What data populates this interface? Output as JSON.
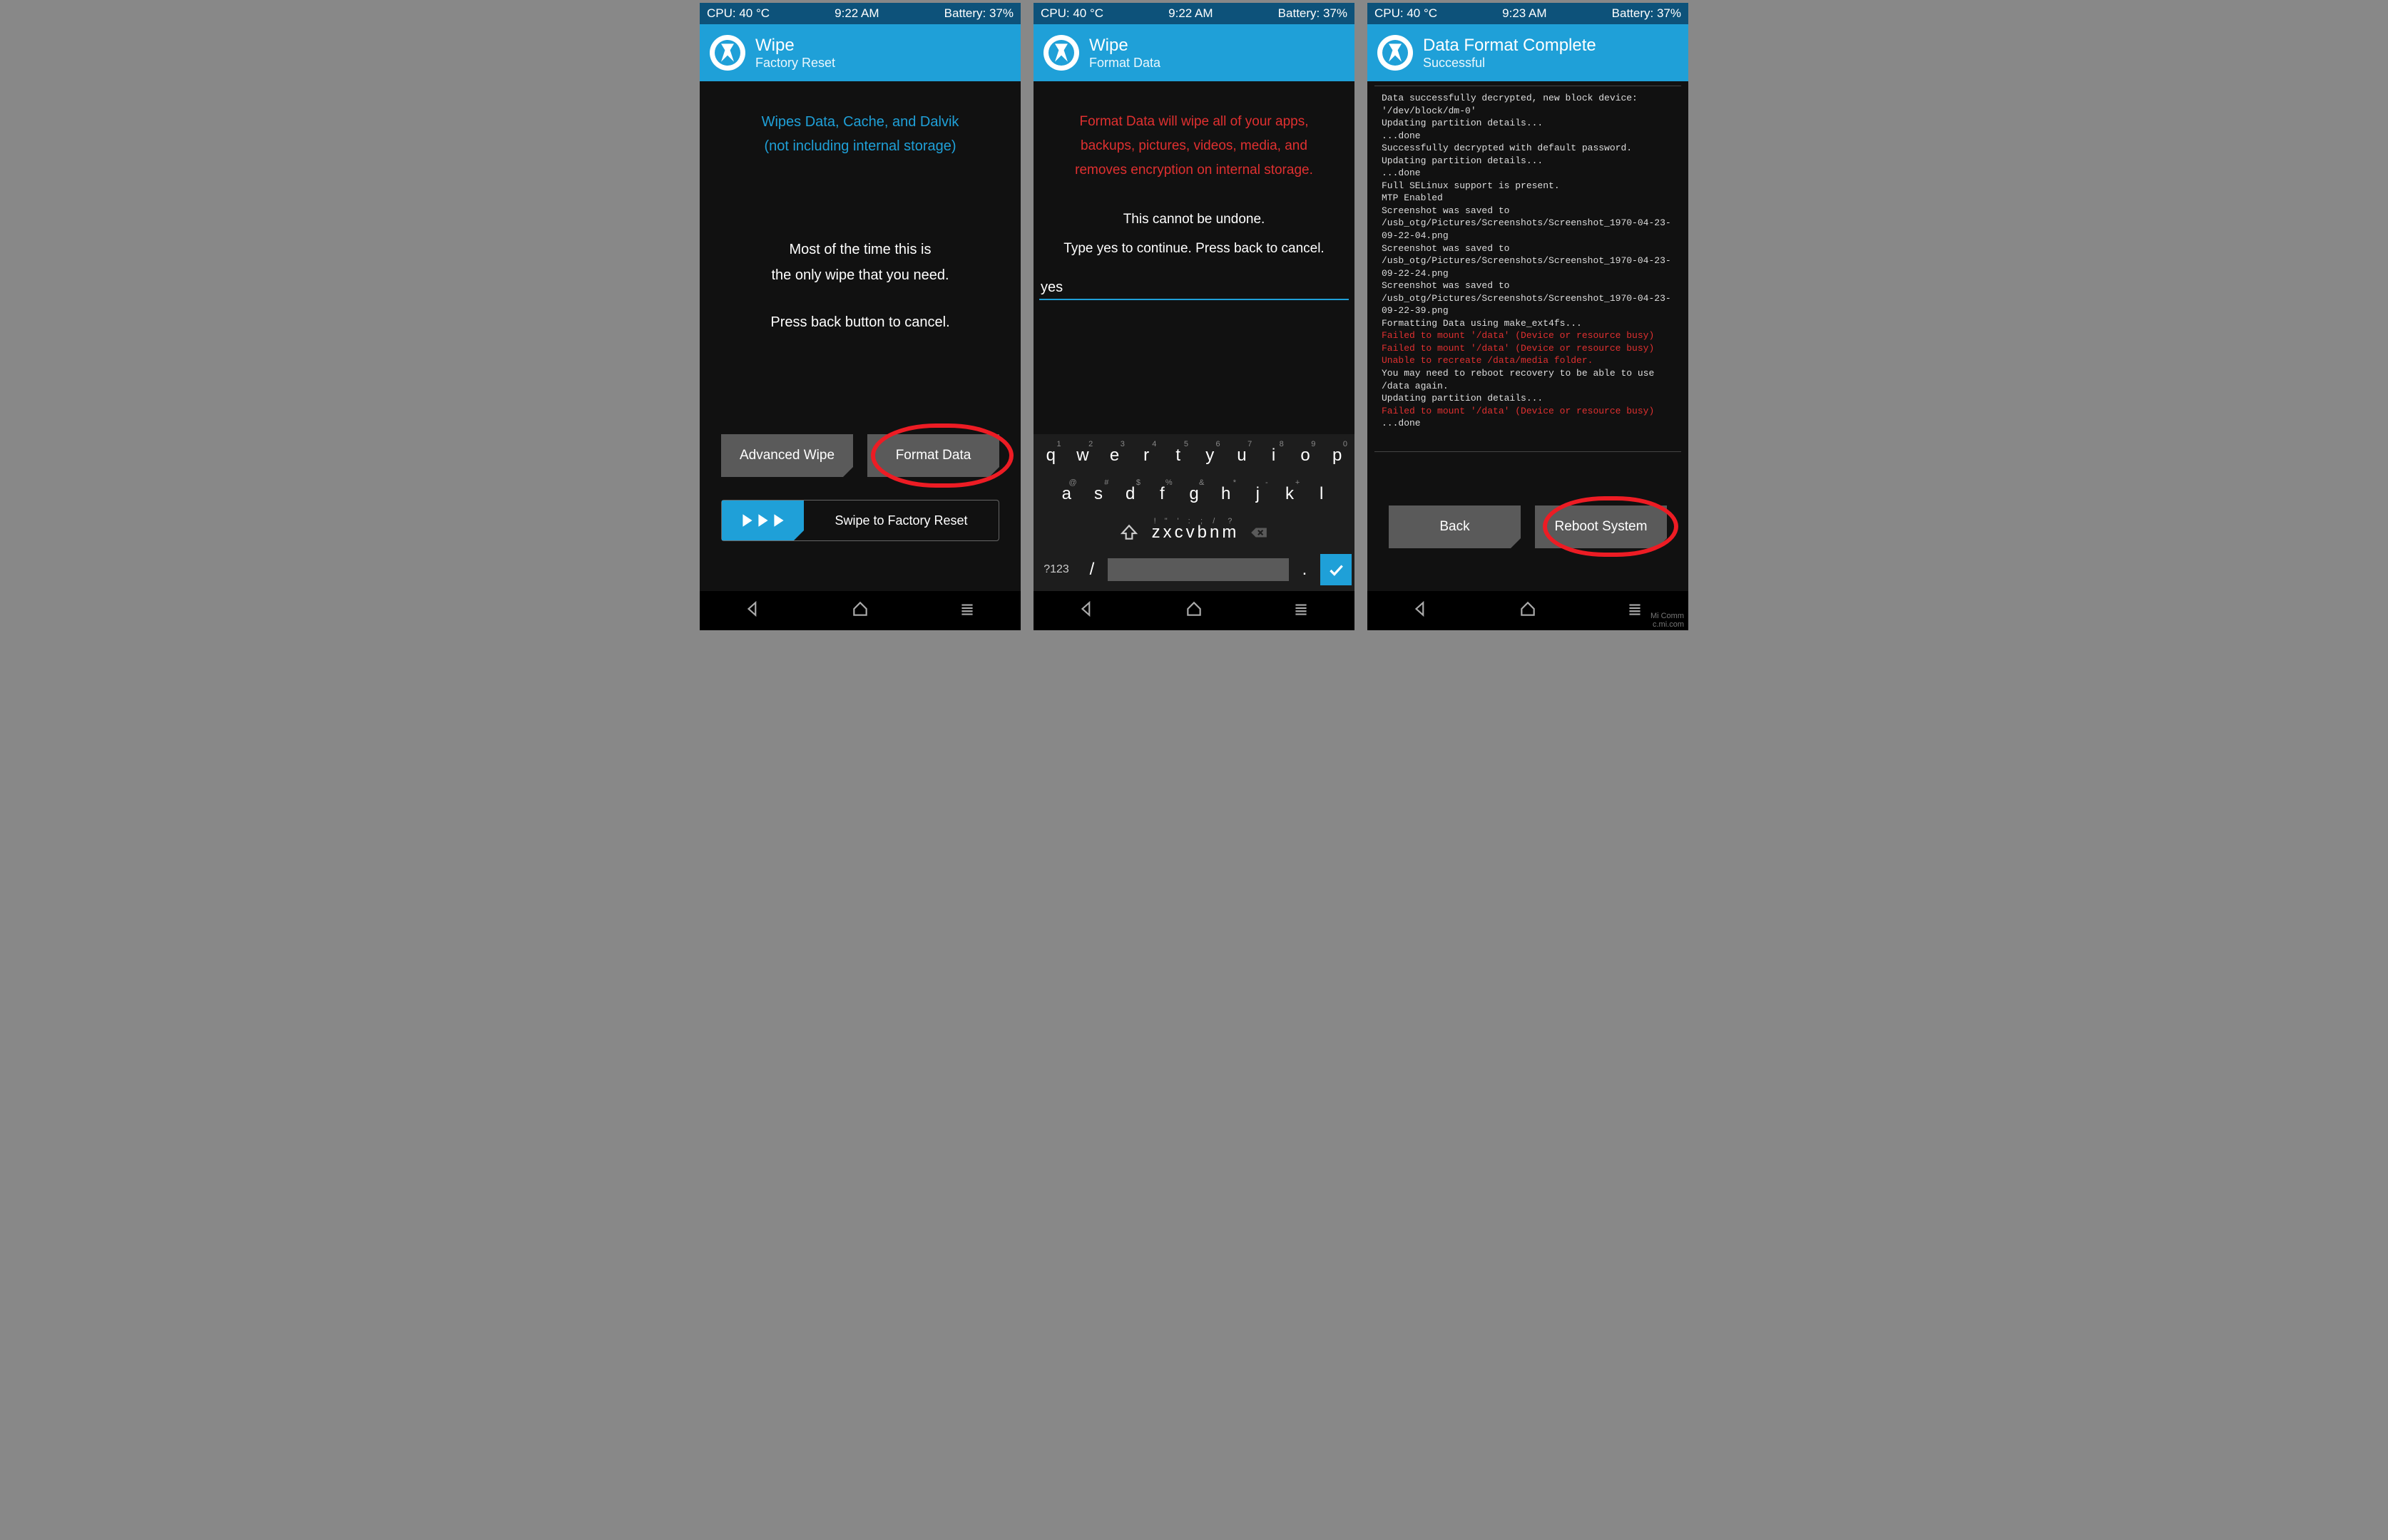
{
  "screen1": {
    "status": {
      "cpu": "CPU: 40 °C",
      "time": "9:22 AM",
      "battery": "Battery: 37%"
    },
    "title": "Wipe",
    "subtitle": "Factory Reset",
    "info1": "Wipes Data, Cache, and Dalvik",
    "info2": "(not including internal storage)",
    "body1": "Most of the time this is",
    "body2": "the only wipe that you need.",
    "body3": "Press back button to cancel.",
    "btn_advanced": "Advanced Wipe",
    "btn_format": "Format Data",
    "swipe_label": "Swipe to Factory Reset"
  },
  "screen2": {
    "status": {
      "cpu": "CPU: 40 °C",
      "time": "9:22 AM",
      "battery": "Battery: 37%"
    },
    "title": "Wipe",
    "subtitle": "Format Data",
    "warn1": "Format Data will wipe all of your apps,",
    "warn2": "backups, pictures, videos, media, and",
    "warn3": "removes encryption on internal storage.",
    "body1": "This cannot be undone.",
    "body2": "Type yes to continue.  Press back to cancel.",
    "input_value": "yes",
    "kb": {
      "row1": [
        {
          "k": "q",
          "h": "1"
        },
        {
          "k": "w",
          "h": "2"
        },
        {
          "k": "e",
          "h": "3"
        },
        {
          "k": "r",
          "h": "4"
        },
        {
          "k": "t",
          "h": "5"
        },
        {
          "k": "y",
          "h": "6"
        },
        {
          "k": "u",
          "h": "7"
        },
        {
          "k": "i",
          "h": "8"
        },
        {
          "k": "o",
          "h": "9"
        },
        {
          "k": "p",
          "h": "0"
        }
      ],
      "row2": [
        {
          "k": "a",
          "h": "@"
        },
        {
          "k": "s",
          "h": "#"
        },
        {
          "k": "d",
          "h": "$"
        },
        {
          "k": "f",
          "h": "%"
        },
        {
          "k": "g",
          "h": "&"
        },
        {
          "k": "h",
          "h": "*"
        },
        {
          "k": "j",
          "h": "-"
        },
        {
          "k": "k",
          "h": "+"
        },
        {
          "k": "l",
          "h": ""
        }
      ],
      "row3": [
        {
          "k": "z",
          "h": "!"
        },
        {
          "k": "x",
          "h": "\""
        },
        {
          "k": "c",
          "h": "'"
        },
        {
          "k": "v",
          "h": ":"
        },
        {
          "k": "b",
          "h": ";"
        },
        {
          "k": "n",
          "h": "/"
        },
        {
          "k": "m",
          "h": "?"
        }
      ],
      "mode": "?123"
    }
  },
  "screen3": {
    "status": {
      "cpu": "CPU: 40 °C",
      "time": "9:23 AM",
      "battery": "Battery: 37%"
    },
    "title": "Data Format Complete",
    "subtitle": "Successful",
    "log_lines": [
      {
        "t": "Data successfully decrypted, new block device: '/dev/block/dm-0'",
        "err": false
      },
      {
        "t": "Updating partition details...",
        "err": false
      },
      {
        "t": "...done",
        "err": false
      },
      {
        "t": "Successfully decrypted with default password.",
        "err": false
      },
      {
        "t": "Updating partition details...",
        "err": false
      },
      {
        "t": "...done",
        "err": false
      },
      {
        "t": "Full SELinux support is present.",
        "err": false
      },
      {
        "t": "MTP Enabled",
        "err": false
      },
      {
        "t": "Screenshot was saved to /usb_otg/Pictures/Screenshots/Screenshot_1970-04-23-09-22-04.png",
        "err": false
      },
      {
        "t": "Screenshot was saved to /usb_otg/Pictures/Screenshots/Screenshot_1970-04-23-09-22-24.png",
        "err": false
      },
      {
        "t": "Screenshot was saved to /usb_otg/Pictures/Screenshots/Screenshot_1970-04-23-09-22-39.png",
        "err": false
      },
      {
        "t": "Formatting Data using make_ext4fs...",
        "err": false
      },
      {
        "t": "Failed to mount '/data' (Device or resource busy)",
        "err": true
      },
      {
        "t": "Failed to mount '/data' (Device or resource busy)",
        "err": true
      },
      {
        "t": "Unable to recreate /data/media folder.",
        "err": true
      },
      {
        "t": "You may need to reboot recovery to be able to use /data again.",
        "err": false
      },
      {
        "t": "Updating partition details...",
        "err": false
      },
      {
        "t": "Failed to mount '/data' (Device or resource busy)",
        "err": true
      },
      {
        "t": "...done",
        "err": false
      }
    ],
    "btn_back": "Back",
    "btn_reboot": "Reboot System"
  },
  "watermark": {
    "line1": "Mi Comm",
    "line2": "c.mi.com"
  }
}
